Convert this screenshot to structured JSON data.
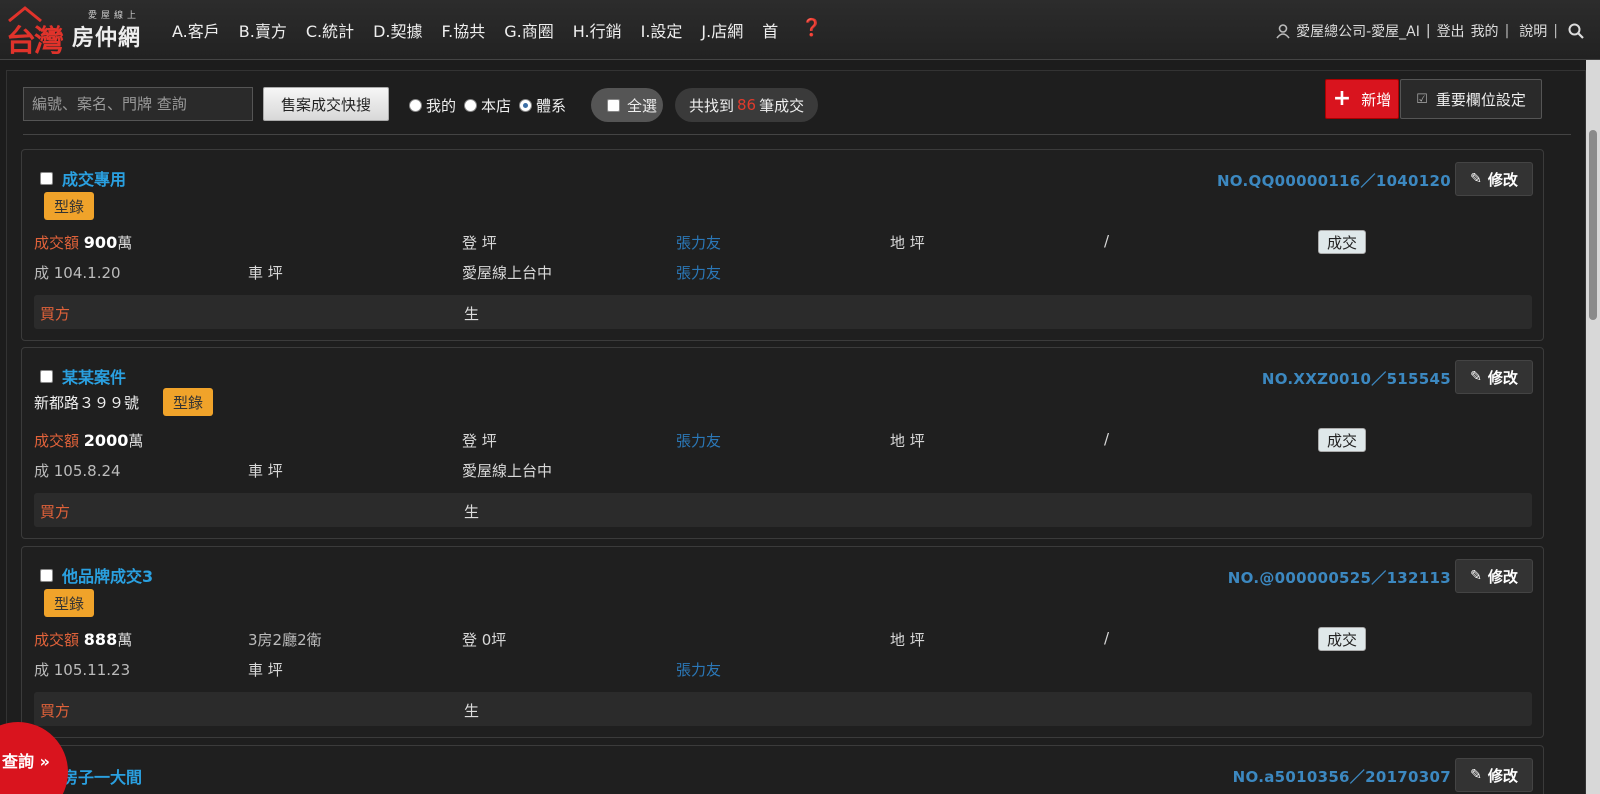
{
  "app": {
    "logo_main": "台灣",
    "logo_small": "愛屋線上",
    "logo_sub": "房仲網"
  },
  "nav": [
    {
      "label": "A.客戶"
    },
    {
      "label": "B.賣方"
    },
    {
      "label": "C.統計"
    },
    {
      "label": "D.契據"
    },
    {
      "label": "F.協共"
    },
    {
      "label": "G.商圈"
    },
    {
      "label": "H.行銷"
    },
    {
      "label": "I.設定"
    },
    {
      "label": "J.店網"
    },
    {
      "label": "首"
    }
  ],
  "nav_help": "❓",
  "user": {
    "name": "愛屋總公司-愛屋_AI",
    "logout": "登出",
    "mine": "我的",
    "help": "說明"
  },
  "toolbar": {
    "search_placeholder": "編號、案名、門牌 查詢",
    "quick_search": "售案成交快搜",
    "radio_mine": "我的",
    "radio_store": "本店",
    "radio_system": "體系",
    "select_all": "全選",
    "found_prefix": "共找到",
    "found_count": "86",
    "found_suffix": "筆成交",
    "add_label": "新增",
    "fields_label": "重要欄位設定"
  },
  "cards": [
    {
      "name": "成交專用",
      "address": "",
      "tag": "型錄",
      "case_no": "NO.QQ00000116／1040120",
      "edit": "修改",
      "deal_label": "成交額",
      "deal_value": "900",
      "deal_unit": "萬",
      "layout": "",
      "reg_area": "登 坪",
      "agent1": "張力友",
      "land": "地 坪",
      "slash": "/",
      "status": "成交",
      "date": "成 104.1.20",
      "parking": "車 坪",
      "store": "愛屋線上台中",
      "agent2": "張力友",
      "buyer_label": "買方",
      "buyer_value": "生"
    },
    {
      "name": "某某案件",
      "address": "新都路３９９號",
      "tag": "型錄",
      "case_no": "NO.XXZ0010／515545",
      "edit": "修改",
      "deal_label": "成交額",
      "deal_value": "2000",
      "deal_unit": "萬",
      "layout": "",
      "reg_area": "登 坪",
      "agent1": "張力友",
      "land": "地 坪",
      "slash": "/",
      "status": "成交",
      "date": "成 105.8.24",
      "parking": "車 坪",
      "store": "愛屋線上台中",
      "agent2": "",
      "buyer_label": "買方",
      "buyer_value": "生"
    },
    {
      "name": "他品牌成交3",
      "address": "",
      "tag": "型錄",
      "case_no": "NO.@000000525／132113",
      "edit": "修改",
      "deal_label": "成交額",
      "deal_value": "888",
      "deal_unit": "萬",
      "layout": "3房2廳2衛",
      "reg_area": "登 0坪",
      "agent1": "",
      "land": "地 坪",
      "slash": "/",
      "status": "成交",
      "date": "成 105.11.23",
      "parking": "車 坪",
      "store": "",
      "agent2": "張力友",
      "buyer_label": "買方",
      "buyer_value": "生"
    },
    {
      "name": "房子一大間",
      "case_no": "NO.a5010356／20170307",
      "edit": "修改"
    }
  ],
  "query_fab": "查詢 »"
}
